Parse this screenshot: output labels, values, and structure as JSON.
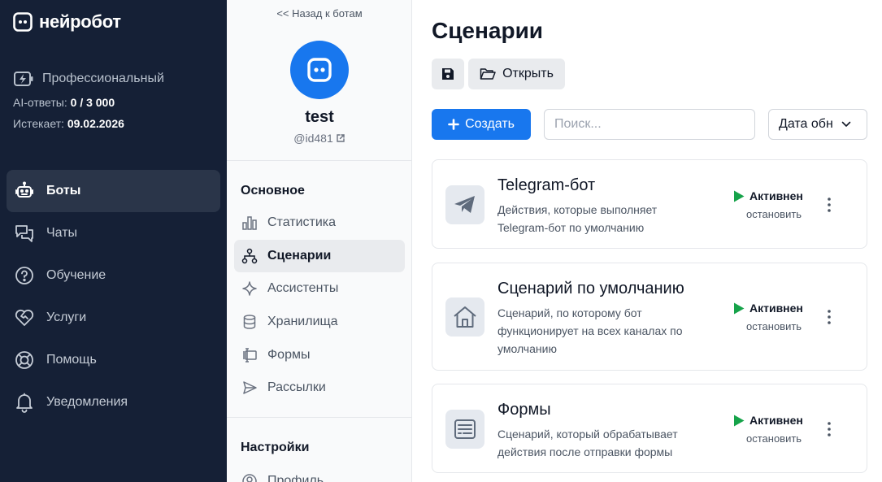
{
  "app": {
    "name": "нейробот"
  },
  "plan": {
    "name": "Профессиональный",
    "ai_label": "AI-ответы:",
    "ai_value": "0 / 3 000",
    "expires_label": "Истекает:",
    "expires_value": "09.02.2026"
  },
  "nav": {
    "items": [
      {
        "label": "Боты",
        "icon": "robot-icon",
        "active": true
      },
      {
        "label": "Чаты",
        "icon": "chat-icon"
      },
      {
        "label": "Обучение",
        "icon": "question-circle-icon"
      },
      {
        "label": "Услуги",
        "icon": "heart-handshake-icon"
      },
      {
        "label": "Помощь",
        "icon": "lifebuoy-icon"
      },
      {
        "label": "Уведомления",
        "icon": "bell-icon"
      }
    ]
  },
  "bot": {
    "back_label": "<< Назад к ботам",
    "name": "test",
    "handle": "@id481",
    "section_main": "Основное",
    "section_settings": "Настройки",
    "menu": [
      {
        "label": "Статистика",
        "icon": "bar-chart-icon"
      },
      {
        "label": "Сценарии",
        "icon": "flow-icon",
        "active": true
      },
      {
        "label": "Ассистенты",
        "icon": "sparkle-icon"
      },
      {
        "label": "Хранилища",
        "icon": "database-icon"
      },
      {
        "label": "Формы",
        "icon": "form-icon"
      },
      {
        "label": "Рассылки",
        "icon": "send-icon"
      }
    ],
    "settings_menu": [
      {
        "label": "Профиль",
        "icon": "user-icon"
      }
    ]
  },
  "main": {
    "title": "Сценарии",
    "open_label": "Открыть",
    "create_label": "Создать",
    "search_placeholder": "Поиск...",
    "sort_label": "Дата обн",
    "scenarios": [
      {
        "title": "Telegram-бот",
        "description": "Действия, которые выполняет Telegram-бот по умолчанию",
        "status": "Активнен",
        "stop_label": "остановить",
        "icon": "telegram-icon"
      },
      {
        "title": "Сценарий по умолчанию",
        "description": "Сценарий, по которому бот функционирует на всех каналах по умолчанию",
        "status": "Активнен",
        "stop_label": "остановить",
        "icon": "home-icon"
      },
      {
        "title": "Формы",
        "description": "Сценарий, который обрабатывает действия после отправки формы",
        "status": "Активнен",
        "stop_label": "остановить",
        "icon": "form-window-icon"
      }
    ]
  },
  "colors": {
    "nav_bg": "#152036",
    "accent": "#1877ee",
    "active_green": "#16a34a"
  }
}
